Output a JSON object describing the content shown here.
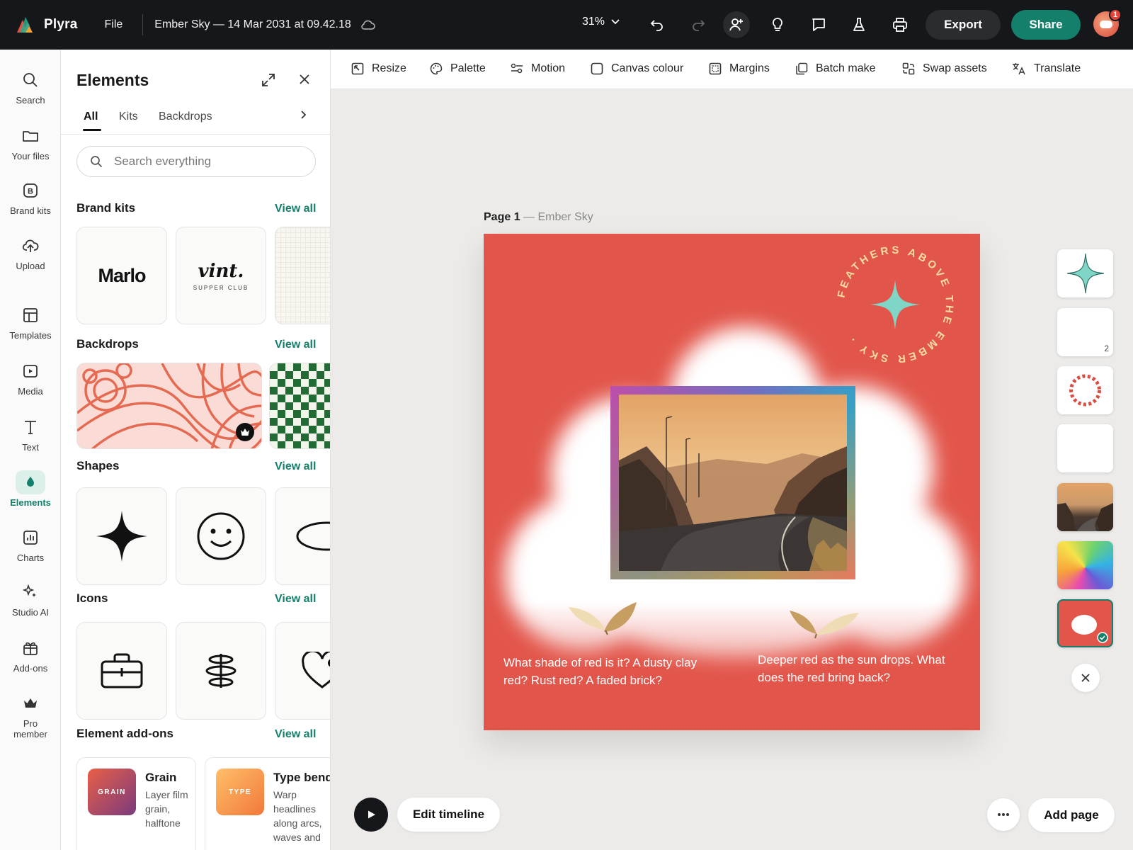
{
  "app": {
    "name": "Plyra",
    "file_menu": "File",
    "doc_title": "Ember Sky — 14 Mar 2031 at 09.42.18",
    "zoom": "31%",
    "export_label": "Export",
    "share_label": "Share",
    "notifications": "1"
  },
  "rail": {
    "items": [
      {
        "label": "Search",
        "icon": "search-icon"
      },
      {
        "label": "Your files",
        "icon": "folder-icon"
      },
      {
        "label": "Brand kits",
        "icon": "brand-kit-icon"
      },
      {
        "label": "Upload",
        "icon": "upload-icon"
      },
      {
        "label": "Templates",
        "icon": "templates-icon"
      },
      {
        "label": "Media",
        "icon": "media-icon"
      },
      {
        "label": "Text",
        "icon": "text-icon"
      },
      {
        "label": "Elements",
        "icon": "elements-icon",
        "active": true
      },
      {
        "label": "Charts",
        "icon": "charts-icon"
      },
      {
        "label": "Studio AI",
        "icon": "sparkle-icon"
      },
      {
        "label": "Add-ons",
        "icon": "gift-icon"
      },
      {
        "label": "Pro member",
        "icon": "crown-icon"
      }
    ]
  },
  "panel": {
    "title": "Elements",
    "tabs": [
      "All",
      "Kits",
      "Backdrops"
    ],
    "search_placeholder": "Search everything",
    "view_all": "View all",
    "sections": {
      "brand_kits": "Brand kits",
      "backdrops": "Backdrops",
      "shapes": "Shapes",
      "icons": "Icons",
      "addons": "Element add-ons"
    },
    "brand_kits": [
      {
        "name": "Marlo"
      },
      {
        "name": "vint.",
        "tagline": "SUPPER CLUB"
      }
    ],
    "addons": [
      {
        "thumb": "GRAIN",
        "name": "Grain",
        "desc": "Layer film grain, halftone"
      },
      {
        "thumb": "TYPE",
        "name": "Type bend",
        "desc": "Warp headlines along arcs, waves and"
      }
    ]
  },
  "toolbar": {
    "tools": [
      {
        "label": "Resize",
        "icon": "resize-icon"
      },
      {
        "label": "Palette",
        "icon": "palette-icon"
      },
      {
        "label": "Motion",
        "icon": "motion-icon"
      },
      {
        "label": "Canvas colour",
        "icon": "canvas-colour-icon"
      },
      {
        "label": "Margins",
        "icon": "margins-icon"
      },
      {
        "label": "Batch make",
        "icon": "batch-make-icon"
      },
      {
        "label": "Swap assets",
        "icon": "swap-assets-icon"
      },
      {
        "label": "Translate",
        "icon": "translate-icon"
      }
    ]
  },
  "canvas": {
    "page_label": "Page 1",
    "page_name": "— Ember Sky",
    "circle_text": "FEATHERS ABOVE THE EMBER SKY ·",
    "caption_left": "What shade of red is it? A dusty clay red? Rust red? A faded brick?",
    "caption_right": "Deeper red as the sun drops. What does the red bring back?",
    "colors": {
      "background": "#e2554a",
      "accent": "#7fd6c6",
      "ring_text": "#f3dca0"
    }
  },
  "thumbnails": {
    "count_label": "2"
  },
  "footer": {
    "edit_timeline": "Edit timeline",
    "add_page": "Add page"
  }
}
